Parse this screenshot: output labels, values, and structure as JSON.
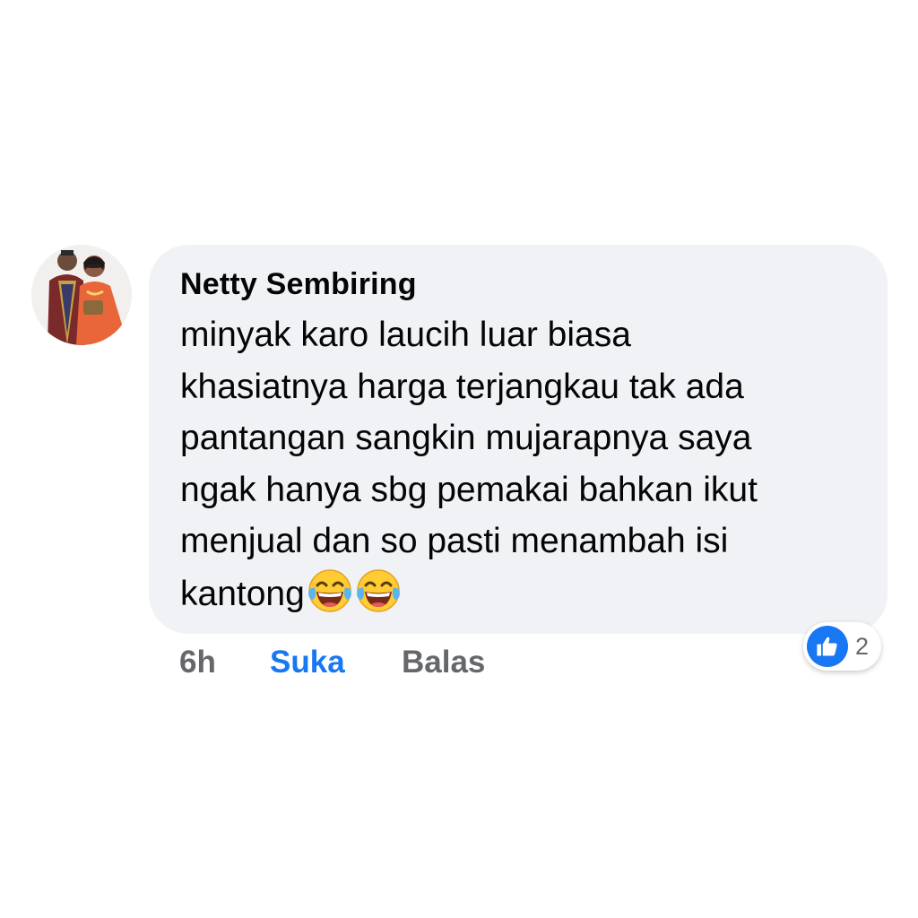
{
  "comment": {
    "author": "Netty Sembiring",
    "text_lines": [
      "minyak karo laucih luar biasa",
      "khasiatnya harga terjangkau tak ada",
      "pantangan sangkin mujarapnya saya",
      "ngak hanya sbg pemakai bahkan ikut",
      "menjual dan so pasti menambah isi",
      "kantong"
    ],
    "emoji": [
      "face-with-tears-of-joy",
      "face-with-tears-of-joy"
    ],
    "reactions": {
      "icon": "like-icon",
      "count": "2",
      "color": "#1877f2"
    },
    "actions": {
      "time": "6h",
      "like_label": "Suka",
      "reply_label": "Balas"
    }
  },
  "colors": {
    "bubble_bg": "#f0f2f5",
    "text": "#050505",
    "secondary": "#65676b",
    "accent": "#1877f2"
  }
}
